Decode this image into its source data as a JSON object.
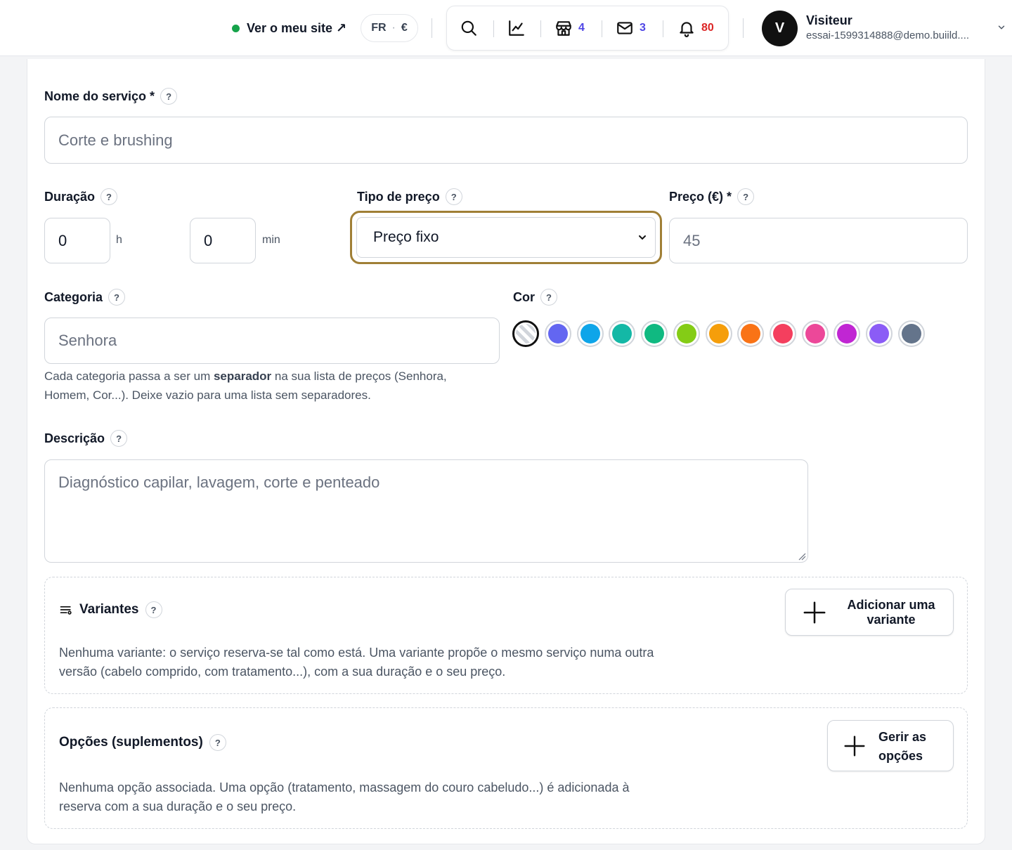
{
  "header": {
    "site_link": "Ver o meu site ↗",
    "language": "FR",
    "currency": "€",
    "counters": {
      "store": "4",
      "mail": "3",
      "notifications": "80"
    },
    "user": {
      "initial": "V",
      "name": "Visiteur",
      "email": "essai-1599314888@demo.buiild...."
    }
  },
  "form": {
    "service_name": {
      "label": "Nome do serviço *",
      "placeholder": "Corte e brushing"
    },
    "duration": {
      "label": "Duração",
      "hours": "0",
      "hours_unit": "h",
      "minutes": "0",
      "minutes_unit": "min"
    },
    "price_type": {
      "label": "Tipo de preço",
      "selected": "Preço fixo"
    },
    "price": {
      "label": "Preço (€) *",
      "placeholder": "45"
    },
    "category": {
      "label": "Categoria",
      "placeholder": "Senhora",
      "hint_before": "Cada categoria passa a ser um ",
      "hint_bold": "separador",
      "hint_after": " na sua lista de preços (Senhora, Homem, Cor...). Deixe vazio para uma lista sem separadores."
    },
    "color": {
      "label": "Cor",
      "options": [
        "#6366f1",
        "#0ea5e9",
        "#14b8a6",
        "#10b981",
        "#84cc16",
        "#f59e0b",
        "#f97316",
        "#f43f5e",
        "#ec4899",
        "#c026d3",
        "#8b5cf6",
        "#64748b"
      ]
    },
    "description": {
      "label": "Descrição",
      "placeholder": "Diagnóstico capilar, lavagem, corte e penteado"
    },
    "variants": {
      "title": "Variantes",
      "button": "Adicionar uma variante",
      "text": "Nenhuma variante: o serviço reserva-se tal como está. Uma variante propõe o mesmo serviço numa outra versão (cabelo comprido, com tratamento...), com a sua duração e o seu preço."
    },
    "options": {
      "title": "Opções (suplementos)",
      "button": "Gerir as opções",
      "text": "Nenhuma opção associada. Uma opção (tratamento, massagem do couro cabeludo...) é adicionada à reserva com a sua duração e o seu preço."
    }
  }
}
